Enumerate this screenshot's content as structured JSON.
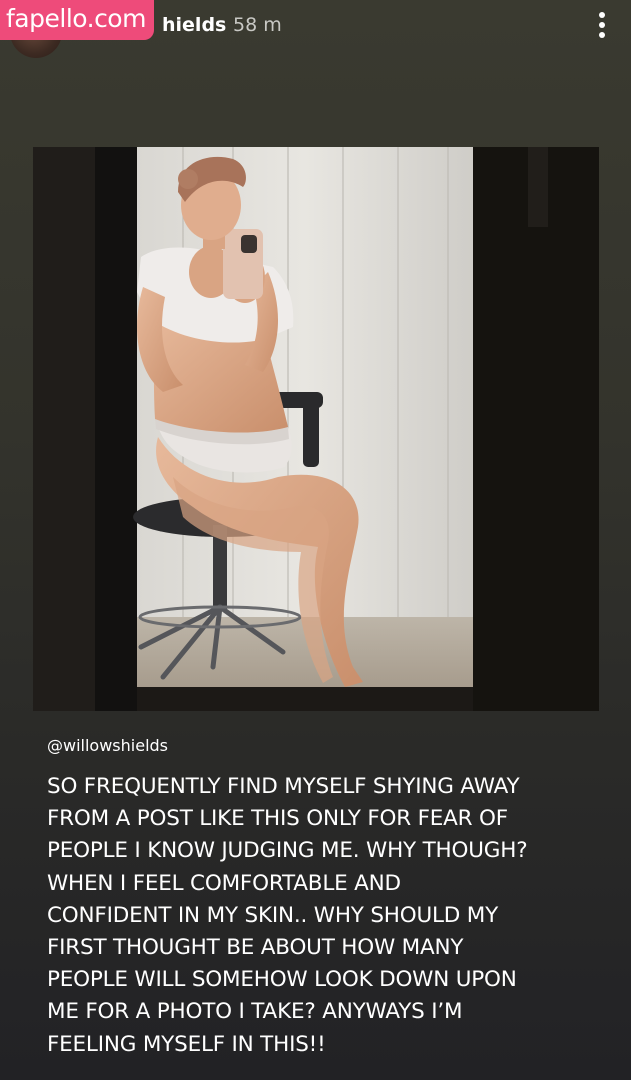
{
  "watermark": {
    "label": "fapello.com",
    "color": "#ee4b7a"
  },
  "story_header": {
    "username_visible": "hields",
    "time_ago": "58 m",
    "more_icon": "more-vertical-icon"
  },
  "post": {
    "image_description_icon": "photo",
    "mention": "@willowshields",
    "caption_lines": [
      "SO FREQUENTLY FIND MYSELF SHYING AWAY",
      "FROM A POST LIKE THIS ONLY FOR FEAR OF",
      "PEOPLE I KNOW JUDGING ME. WHY THOUGH?",
      "WHEN I FEEL COMFORTABLE AND",
      "CONFIDENT IN MY SKIN.. WHY SHOULD MY",
      "FIRST THOUGHT BE ABOUT HOW MANY",
      "PEOPLE WILL SOMEHOW LOOK DOWN UPON",
      "ME FOR A PHOTO I TAKE? ANYWAYS I’M",
      "FEELING MYSELF IN THIS!!"
    ]
  },
  "colors": {
    "background_top": "#3a3a30",
    "background_bottom": "#222225",
    "text": "#ffffff",
    "timestamp": "#c8c8c4"
  }
}
